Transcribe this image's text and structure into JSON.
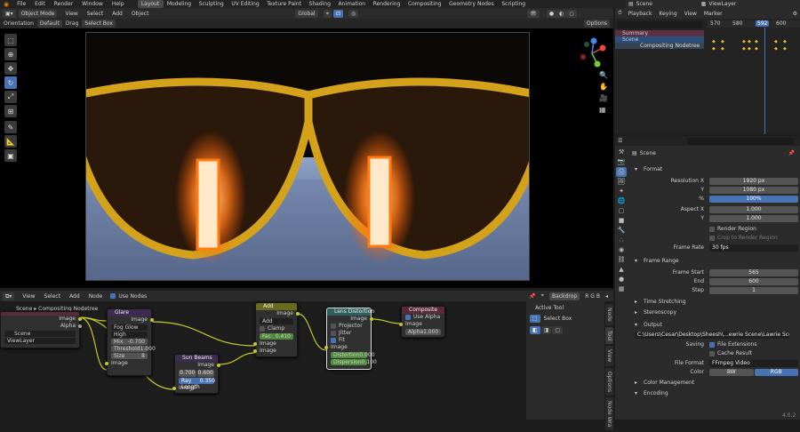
{
  "menu": [
    "File",
    "Edit",
    "Render",
    "Window",
    "Help"
  ],
  "workspaces": [
    "Layout",
    "Modeling",
    "Sculpting",
    "UV Editing",
    "Texture Paint",
    "Shading",
    "Animation",
    "Rendering",
    "Compositing",
    "Geometry Nodes",
    "Scripting"
  ],
  "active_workspace": "Layout",
  "scene_name": "Scene",
  "view_layer": "ViewLayer",
  "viewport": {
    "mode": "Object Mode",
    "menus": [
      "View",
      "Select",
      "Add",
      "Object"
    ],
    "transform": "Global",
    "orientation_label": "Orientation",
    "orientation_value": "Default",
    "drag_label": "Drag",
    "drag_value": "Select Box",
    "options": "Options"
  },
  "timeline": {
    "menus": [
      "Playback",
      "Keying",
      "View",
      "Marker"
    ],
    "ticks": [
      "570",
      "580",
      "592",
      "600"
    ],
    "current": "592",
    "outliner": [
      "Summary",
      "Scene",
      "Compositing Nodetree"
    ]
  },
  "properties": {
    "context": "Scene",
    "format": "Format",
    "resolution_x_label": "Resolution X",
    "resolution_x": "1920 px",
    "y_label": "Y",
    "resolution_y": "1080 px",
    "pct_label": "%",
    "percent": "100%",
    "aspect_x_label": "Aspect X",
    "aspect_x": "1.000",
    "aspect_y": "1.000",
    "render_region": "Render Region",
    "crop": "Crop to Render Region",
    "frame_rate_label": "Frame Rate",
    "frame_rate": "30 fps",
    "frame_range": "Frame Range",
    "frame_start_label": "Frame Start",
    "frame_start": "565",
    "end_label": "End",
    "frame_end": "600",
    "step_label": "Step",
    "step": "1",
    "time_stretching": "Time Stretching",
    "stereoscopy": "Stereoscopy",
    "output": "Output",
    "output_path": "C:\\Users\\Cesar\\Desktop\\Sheesh\\...ewrie Scene\\Lawrie Scene Video",
    "saving_label": "Saving",
    "file_extensions": "File Extensions",
    "cache_result": "Cache Result",
    "file_format_label": "File Format",
    "file_format": "FFmpeg Video",
    "color_label": "Color",
    "color_bw": "BW",
    "color_rgb": "RGB",
    "color_management": "Color Management",
    "encoding": "Encoding",
    "version": "4.0.2"
  },
  "node_editor": {
    "menus": [
      "View",
      "Select",
      "Add",
      "Node"
    ],
    "use_nodes": "Use Nodes",
    "backdrop": "Backdrop",
    "channels": "R G B",
    "tree_name": "Compositing Nodetree",
    "active_tool": "Active Tool",
    "select_box": "Select Box",
    "tabs": [
      "Node",
      "Tool",
      "View",
      "Options",
      "Node Wra"
    ],
    "render_layers": {
      "scene": "Scene",
      "layer": "ViewLayer",
      "image": "Image",
      "alpha": "Alpha"
    },
    "glare": {
      "title": "Glare",
      "image_in": "Image",
      "image_out": "Image",
      "type": "Fog Glow",
      "quality": "High",
      "mix_label": "Mix",
      "mix": "-0.700",
      "threshold_label": "Threshold",
      "threshold": "1.000",
      "size_label": "Size",
      "size": "8"
    },
    "sunbeams": {
      "title": "Sun Beams",
      "image_out": "Image",
      "image_in": "Image",
      "x": "0.700",
      "y": "0.600",
      "ray_label": "Ray Length",
      "ray": "0.350"
    },
    "add": {
      "title": "Add",
      "image_out": "Image",
      "op": "Add",
      "clamp": "Clamp",
      "fac_label": "Fac",
      "fac": "0.410",
      "in1": "Image",
      "in2": "Image"
    },
    "lens": {
      "title": "Lens Distortion",
      "image_out": "Image",
      "projector": "Projector",
      "jitter": "Jitter",
      "fit": "Fit",
      "image_in": "Image",
      "dist_label": "Distortion",
      "dist": "0.000",
      "disp_label": "Dispersion",
      "disp": "0.100"
    },
    "composite": {
      "title": "Composite",
      "use_alpha": "Use Alpha",
      "image": "Image",
      "alpha_label": "Alpha",
      "alpha": "1.000"
    }
  },
  "colors": {
    "accent": "#4772b3",
    "socket": "#c7c729",
    "glare_header": "#3d2b50",
    "add_header": "#6b6b1e",
    "lens_header": "#2f5e5e",
    "composite_header": "#5a2a3a",
    "sun_header": "#3d2b50"
  }
}
